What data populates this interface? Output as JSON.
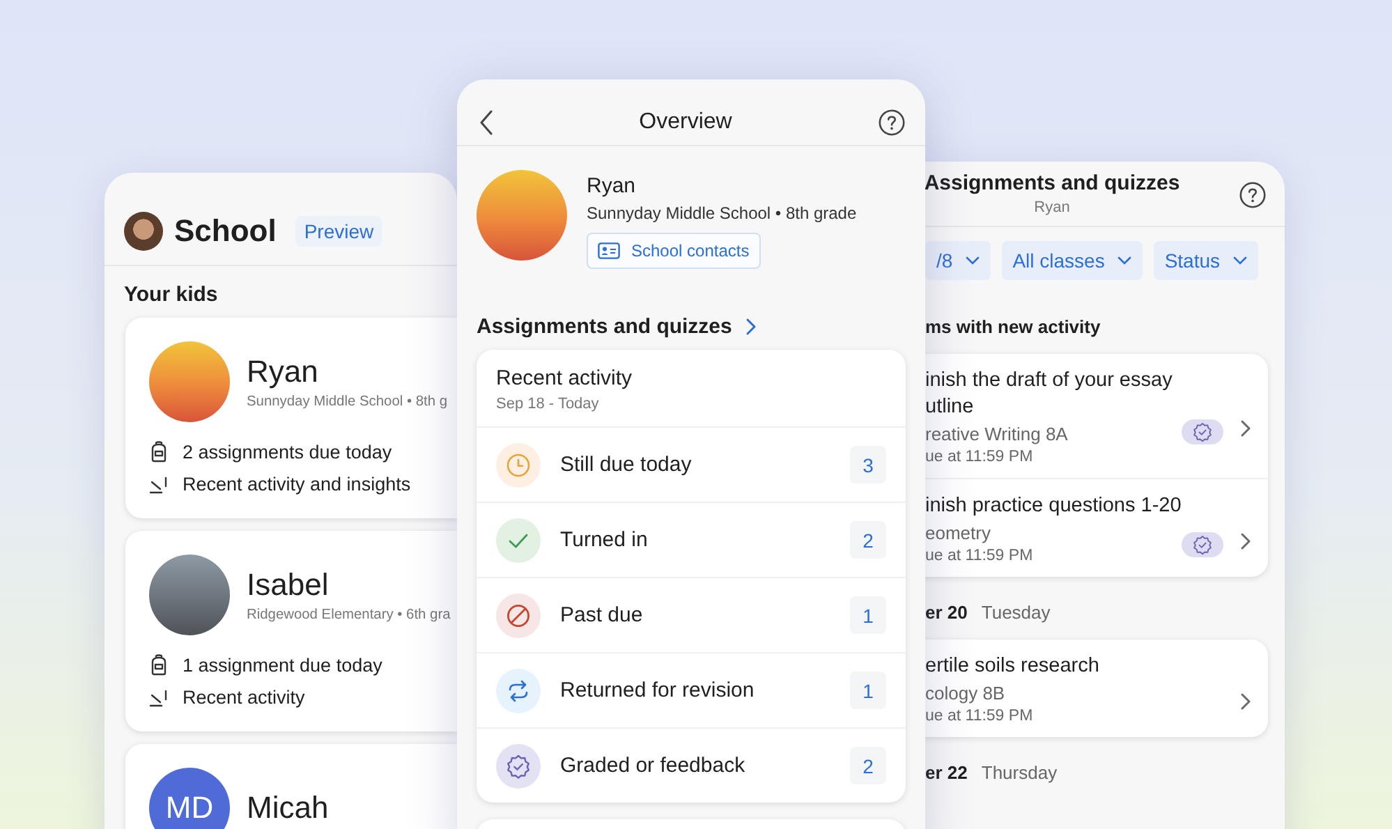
{
  "left_panel": {
    "title": "School",
    "badge": "Preview",
    "section": "Your kids",
    "kids": [
      {
        "name": "Ryan",
        "school": "Sunnyday Middle School • 8th g",
        "photo": true,
        "lines": [
          {
            "kind": "assignments",
            "text": "2 assignments due today"
          },
          {
            "kind": "activity",
            "text": "Recent activity and insights"
          }
        ]
      },
      {
        "name": "Isabel",
        "school": "Ridgewood Elementary • 6th gra",
        "photo": true,
        "lines": [
          {
            "kind": "assignments",
            "text": "1 assignment due today"
          },
          {
            "kind": "activity",
            "text": "Recent activity"
          }
        ]
      },
      {
        "name": "Micah",
        "initials": "MD",
        "photo": false
      }
    ]
  },
  "overview": {
    "title": "Overview",
    "student": {
      "name": "Ryan",
      "school": "Sunnyday Middle School • 8th grade",
      "contacts_button": "School contacts"
    },
    "section": "Assignments and quizzes",
    "card": {
      "title": "Recent activity",
      "range": "Sep 18 - Today",
      "rows": [
        {
          "kind": "due",
          "label": "Still due today",
          "count": "3"
        },
        {
          "kind": "turned_in",
          "label": "Turned in",
          "count": "2"
        },
        {
          "kind": "past_due",
          "label": "Past due",
          "count": "1"
        },
        {
          "kind": "returned",
          "label": "Returned for revision",
          "count": "1"
        },
        {
          "kind": "graded",
          "label": "Graded or feedback",
          "count": "2"
        }
      ]
    }
  },
  "assignments_panel": {
    "title": "Assignments and quizzes",
    "subtitle": "Ryan",
    "filters": [
      "/8",
      "All classes",
      "Status"
    ],
    "groups": [
      {
        "heading": "ms with new activity",
        "items": [
          {
            "title_lines": [
              "inish the draft of your essay",
              "utline"
            ],
            "class": "reative Writing 8A",
            "due": "ue at 11:59 PM",
            "graded": true
          },
          {
            "title_lines": [
              "inish practice questions 1-20"
            ],
            "class": "eometry",
            "due": "ue at 11:59 PM",
            "graded": true
          }
        ]
      },
      {
        "date": "er 20",
        "day": "Tuesday",
        "items": [
          {
            "title_lines": [
              "ertile soils research"
            ],
            "class": "cology 8B",
            "due": "ue at 11:59 PM",
            "graded": false
          }
        ]
      },
      {
        "date": "er 22",
        "day": "Thursday"
      }
    ]
  }
}
